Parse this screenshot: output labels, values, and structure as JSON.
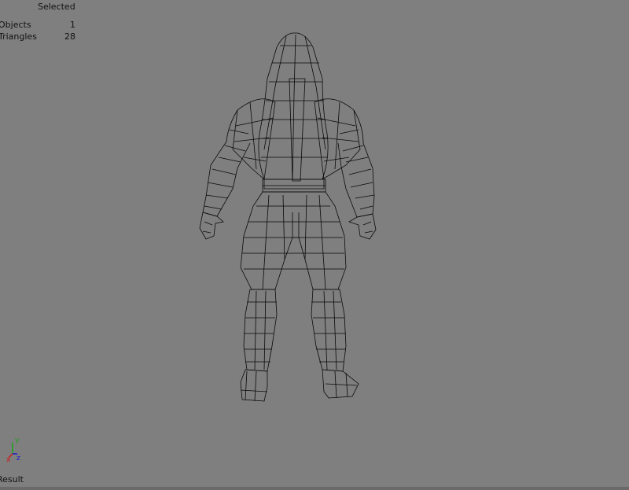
{
  "viewport": {
    "background": "#7f7f7f",
    "wire_color": "#0a0a0a",
    "hud": {
      "header": "Selected",
      "objects_label": "Objects",
      "objects_value": "1",
      "triangles_label": "Triangles",
      "triangles_value": "28"
    },
    "axes": {
      "x": "x",
      "y": "Y",
      "z": "z"
    },
    "status_text": "Result"
  }
}
